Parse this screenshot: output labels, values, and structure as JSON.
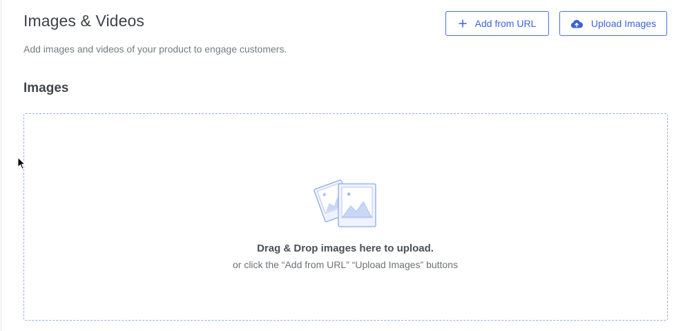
{
  "section": {
    "title": "Images & Videos",
    "description": "Add images and videos of your product to engage customers."
  },
  "buttons": {
    "add_from_url": "Add from URL",
    "upload_images": "Upload Images"
  },
  "images": {
    "heading": "Images"
  },
  "dropzone": {
    "title": "Drag & Drop images here to upload.",
    "hint": "or click the “Add from URL” “Upload Images” buttons"
  },
  "icons": {
    "add": "plus-icon",
    "upload": "cloud-upload-icon",
    "illustration": "photos-illustration-icon",
    "cursor": "mouse-cursor-icon"
  },
  "colors": {
    "accent": "#3a63d9",
    "dropzone_border": "#93aee6",
    "illustration_stroke": "#8ea8e8",
    "illustration_fill": "#eef3fd"
  }
}
